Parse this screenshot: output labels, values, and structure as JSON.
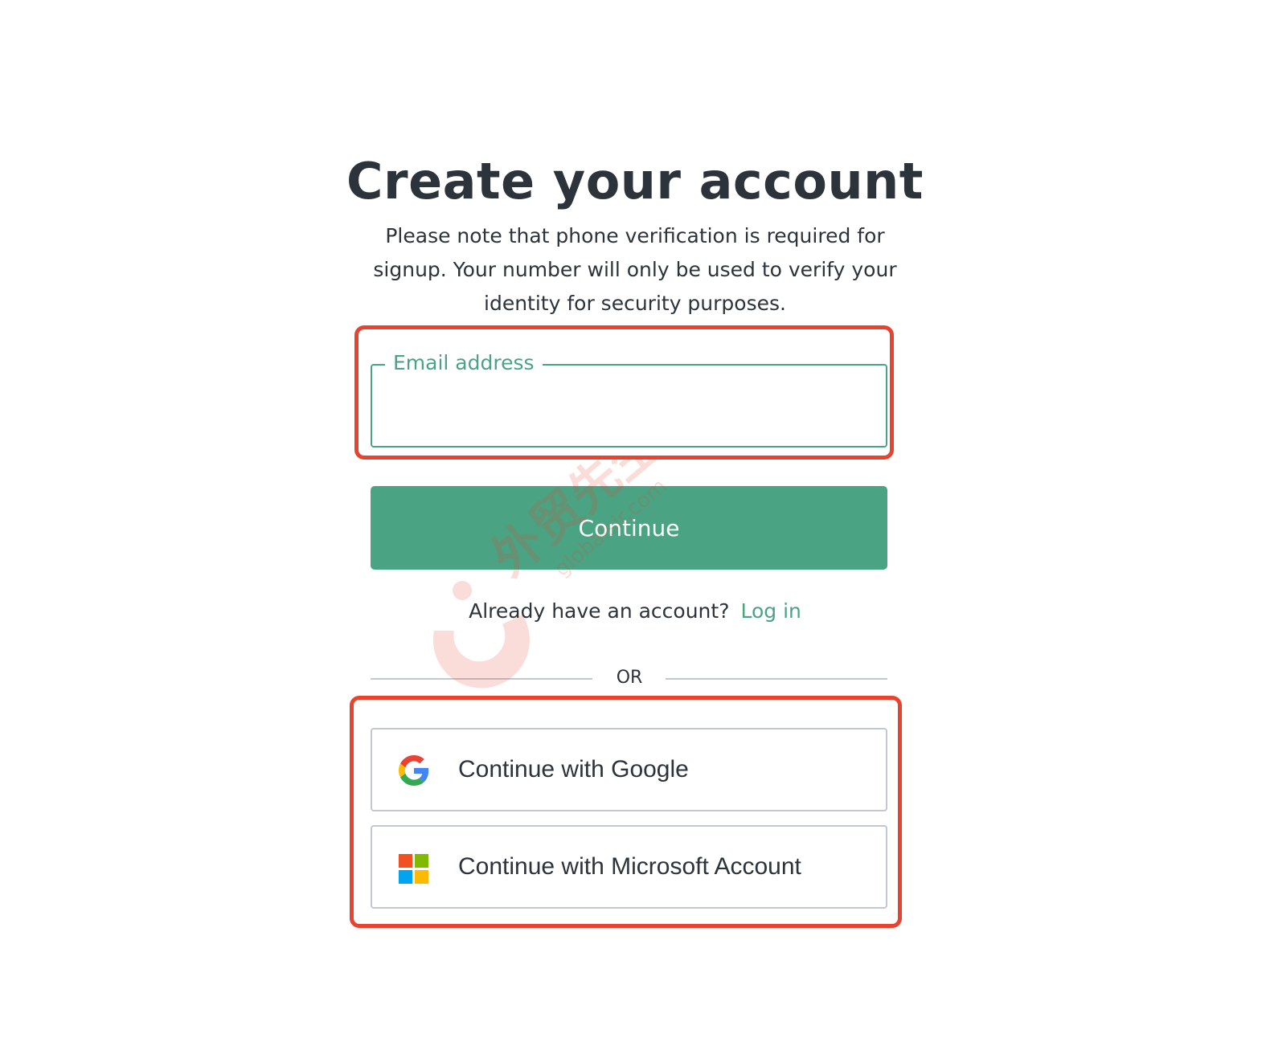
{
  "page": {
    "title": "Create your account",
    "subtitle": "Please note that phone verification is required for signup. Your number will only be used to verify your identity for security purposes."
  },
  "email": {
    "label": "Email address",
    "value": ""
  },
  "continue_label": "Continue",
  "login": {
    "prompt": "Already have an account?",
    "link_label": "Log in"
  },
  "divider_label": "OR",
  "social": {
    "google_label": "Continue with Google",
    "microsoft_label": "Continue with Microsoft Account"
  },
  "watermark": {
    "text": "外贸先生",
    "subtext": "globalsir.com"
  },
  "colors": {
    "accent": "#4aa382",
    "highlight": "#e8432e",
    "text": "#2d333a",
    "border": "#c2c8d0",
    "ms_red": "#f25022",
    "ms_green": "#7fba00",
    "ms_blue": "#00a4ef",
    "ms_yellow": "#ffb900"
  }
}
